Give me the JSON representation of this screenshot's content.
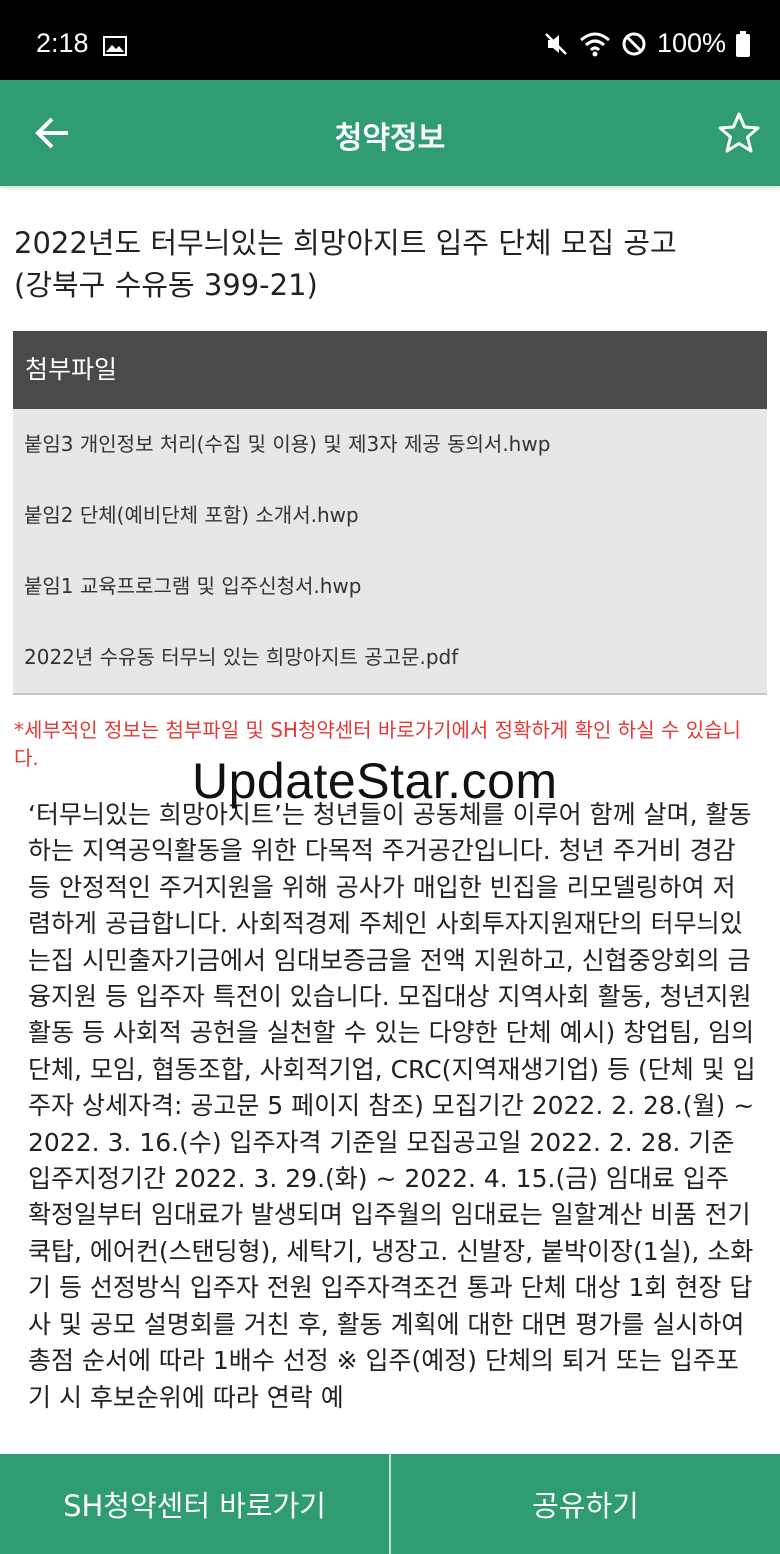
{
  "status": {
    "time": "2:18",
    "battery": "100%"
  },
  "appbar": {
    "title": "청약정보"
  },
  "notice": {
    "title": "2022년도 터무늬있는 희망아지트 입주 단체 모집 공고(강북구 수유동 399-21)"
  },
  "attachments": {
    "header": "첨부파일",
    "files": [
      "붙임3 개인정보 처리(수집 및 이용) 및 제3자 제공 동의서.hwp",
      "붙임2 단체(예비단체 포함) 소개서.hwp",
      "붙임1 교육프로그램 및 입주신청서.hwp",
      "2022년 수유동 터무늬 있는 희망아지트 공고문.pdf"
    ]
  },
  "disclaimer": "*세부적인 정보는 첨부파일 및 SH청약센터 바로가기에서 정확하게 확인 하실 수 있습니다.",
  "watermark": "UpdateStar.com",
  "body_text": "‘터무늬있는 희망아지트’는 청년들이 공동체를 이루어 함께 살며, 활동하는 지역공익활동을 위한 다목적 주거공간입니다. 청년 주거비 경감 등 안정적인 주거지원을 위해 공사가 매입한 빈집을 리모델링하여 저렴하게 공급합니다. 사회적경제 주체인 사회투자지원재단의 터무늬있는집 시민출자기금에서 임대보증금을 전액 지원하고, 신협중앙회의 금융지원 등 입주자 특전이 있습니다. 모집대상 지역사회 활동, 청년지원 활동 등 사회적 공헌을 실천할 수 있는 다양한 단체 예시) 창업팀, 임의단체, 모임, 협동조합, 사회적기업, CRC(지역재생기업) 등 (단체 및 입주자 상세자격: 공고문 5 페이지 참조) 모집기간 2022. 2. 28.(월) ~ 2022. 3. 16.(수) 입주자격 기준일 모집공고일 2022. 2. 28. 기준 입주지정기간 2022. 3. 29.(화) ~ 2022. 4. 15.(금) 임대료 입주 확정일부터 임대료가 발생되며 입주월의 임대료는 일할계산 비품 전기쿡탑, 에어컨(스탠딩형), 세탁기, 냉장고. 신발장, 붙박이장(1실), 소화기 등 선정방식 입주자 전원 입주자격조건 통과 단체 대상 1회 현장 답사 및 공모 설명회를 거친 후, 활동 계획에 대한 대면 평가를 실시하여 총점 순서에 따라 1배수 선정 ※ 입주(예정) 단체의 퇴거 또는 입주포기 시 후보순위에 따라 연락 예",
  "bottom": {
    "left_label": "SH청약센터 바로가기",
    "right_label": "공유하기"
  }
}
